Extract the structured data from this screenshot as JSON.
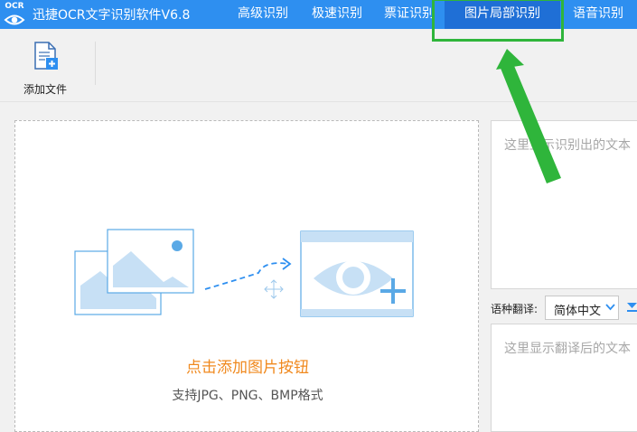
{
  "app": {
    "logo_text": "OCR",
    "title": "迅捷OCR文字识别软件V6.8"
  },
  "tabs": [
    {
      "label": "高级识别"
    },
    {
      "label": "极速识别"
    },
    {
      "label": "票证识别"
    },
    {
      "label": "图片局部识别",
      "active": true
    },
    {
      "label": "语音识别"
    }
  ],
  "toolbar": {
    "add_file_label": "添加文件"
  },
  "dropzone": {
    "title": "点击添加图片按钮",
    "subtitle": "支持JPG、PNG、BMP格式"
  },
  "result": {
    "placeholder": "这里显示识别出的文本"
  },
  "translate": {
    "label": "语种翻译:",
    "selected_language": "简体中文",
    "placeholder": "这里显示翻译后的文本"
  },
  "colors": {
    "title_bar": "#2e8ff0",
    "active_tab": "#1f6fd6",
    "highlight": "#2fb53b",
    "accent_orange": "#f0891e"
  }
}
